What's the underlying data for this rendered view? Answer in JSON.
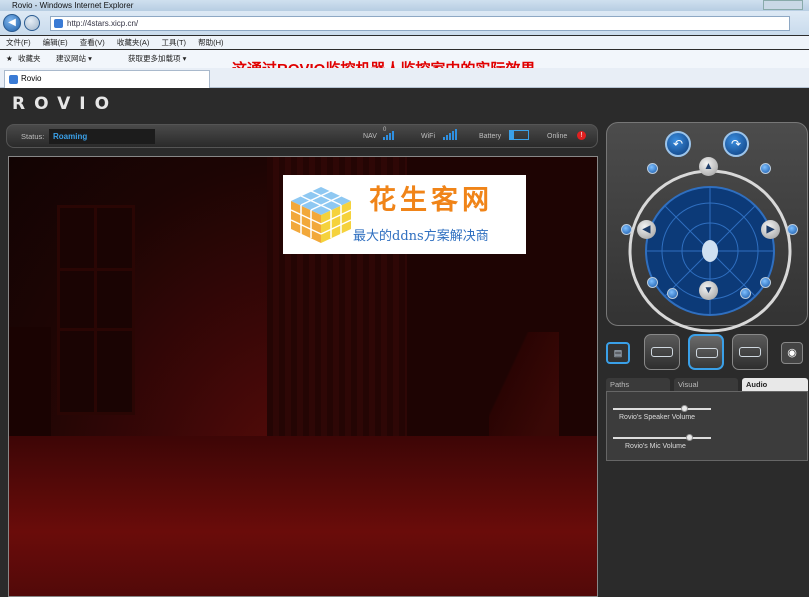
{
  "browser": {
    "title": "Rovio - Windows Internet Explorer",
    "address": "http://4stars.xicp.cn/",
    "menu": [
      "文件(F)",
      "编辑(E)",
      "查看(V)",
      "收藏夹(A)",
      "工具(T)",
      "帮助(H)"
    ],
    "favorites_label": "收藏夹",
    "favorites_links": [
      "建议网站 ▾",
      "获取更多加载项 ▾"
    ],
    "tab_title": "Rovio"
  },
  "banner": "这通过ROVIO监控机器人监控家中的实际效果。",
  "app": {
    "logo": "ROVIO",
    "status_label": "Status:",
    "status_value": "Roaming",
    "nav_label": "NAV",
    "nav_count": "0",
    "wifi_label": "WiFi",
    "battery_label": "Battery",
    "online_label": "Online",
    "accent_color": "#3aa0e8"
  },
  "watermark": {
    "title": "花生客网",
    "subtitle": "最大的ddns方案解决商"
  },
  "panel": {
    "tabs": [
      "Paths",
      "Visual",
      "Audio"
    ],
    "active_tab": "Audio",
    "speaker_label": "Rovio's Speaker Volume",
    "mic_label": "Rovio's Mic Volume",
    "speaker_level": 0.75,
    "mic_level": 0.8
  }
}
